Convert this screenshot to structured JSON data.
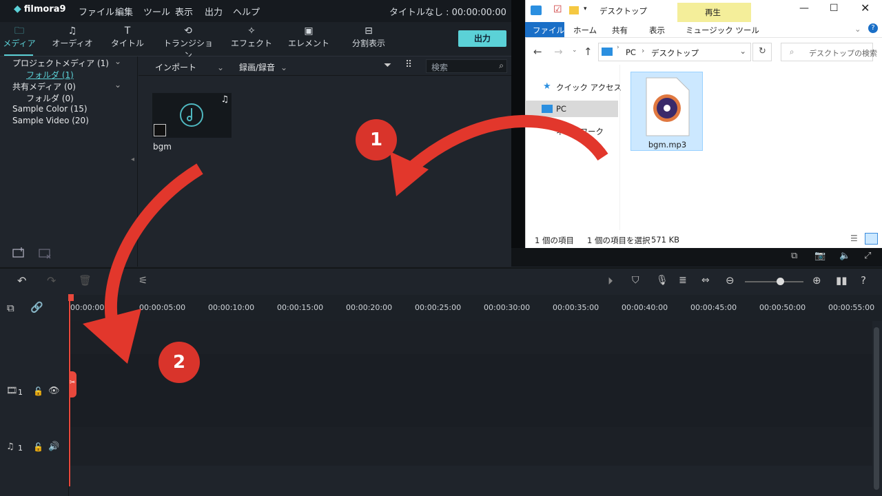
{
  "app": {
    "logo": "filmora9",
    "title": "タイトルなし : 00:00:00:00"
  },
  "menu": [
    "ファイル",
    "編集",
    "ツール",
    "表示",
    "出力",
    "ヘルプ"
  ],
  "tools": [
    {
      "label": "メディア",
      "icon": "folder-icon",
      "glyph": "🗀"
    },
    {
      "label": "オーディオ",
      "icon": "music-note-icon",
      "glyph": "♫"
    },
    {
      "label": "タイトル",
      "icon": "title-icon",
      "glyph": "T"
    },
    {
      "label": "トランジション",
      "icon": "transition-icon",
      "glyph": "⟲"
    },
    {
      "label": "エフェクト",
      "icon": "effect-icon",
      "glyph": "✧"
    },
    {
      "label": "エレメント",
      "icon": "element-icon",
      "glyph": "▣"
    },
    {
      "label": "分割表示",
      "icon": "split-icon",
      "glyph": "⊟"
    }
  ],
  "export_label": "出力",
  "tree": {
    "project": "プロジェクトメディア (1)",
    "project_folder": "フォルダ (1)",
    "shared": "共有メディア (0)",
    "shared_folder": "フォルダ (0)",
    "sample_color": "Sample Color (15)",
    "sample_video": "Sample Video (20)"
  },
  "media_bar": {
    "import": "インポート",
    "record": "録画/録音",
    "search_placeholder": "検索"
  },
  "media_item": {
    "name": "bgm"
  },
  "explorer": {
    "title": "デスクトップ",
    "ribbon_context": "再生",
    "ribbon_tabs": [
      "ファイル",
      "ホーム",
      "共有",
      "表示",
      "ミュージック ツール"
    ],
    "path": [
      "PC",
      "デスクトップ"
    ],
    "search_placeholder": "デスクトップの検索",
    "nav": [
      "クイック アクセス",
      "PC",
      "ネットワーク"
    ],
    "file": "bgm.mp3",
    "status_count": "1 個の項目",
    "status_selected": "1 個の項目を選択",
    "status_size": "571 KB"
  },
  "ruler": [
    "00:00:00:00",
    "00:00:05:00",
    "00:00:10:00",
    "00:00:15:00",
    "00:00:20:00",
    "00:00:25:00",
    "00:00:30:00",
    "00:00:35:00",
    "00:00:40:00",
    "00:00:45:00",
    "00:00:50:00",
    "00:00:55:00"
  ],
  "tracks": {
    "video": "1",
    "audio": "1"
  },
  "annotations": {
    "step1": "1",
    "step2": "2"
  },
  "colors": {
    "accent": "#5bd1d7",
    "annotation": "#d9342b",
    "playhead": "#e8483c"
  }
}
